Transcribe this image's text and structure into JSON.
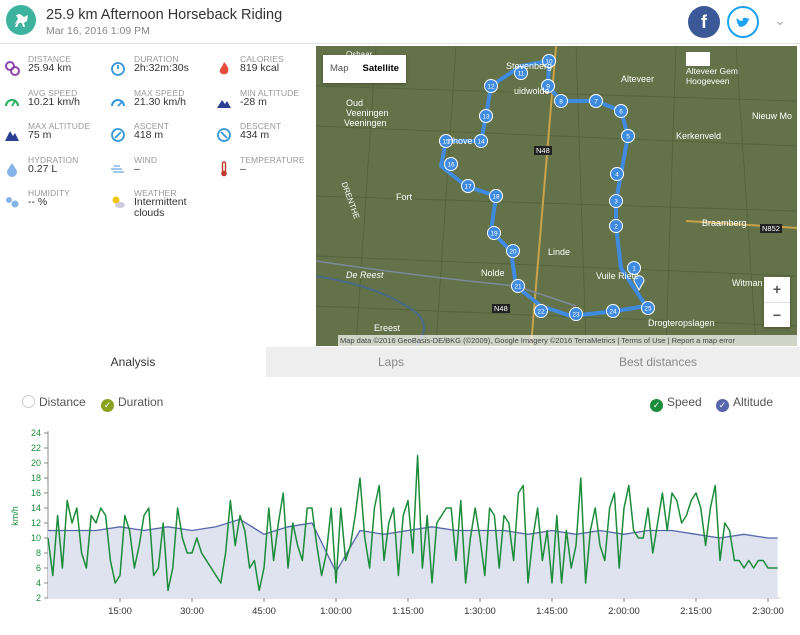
{
  "header": {
    "title": "25.9 km Afternoon Horseback Riding",
    "date": "Mar 16, 2016 1:09 PM",
    "facebook_label": "f"
  },
  "colors": {
    "accent": "#3db39e",
    "speed": "#1b8c3a",
    "altitude": "#5566aa",
    "altitude_fill": "#dfe3f0",
    "facebook": "#3b5998",
    "twitter": "#1da1f2"
  },
  "stats": [
    {
      "icon": "distance-icon",
      "label": "DISTANCE",
      "value": "25.94 km",
      "color": "#8e44ad"
    },
    {
      "icon": "duration-icon",
      "label": "DURATION",
      "value": "2h:32m:30s",
      "color": "#3498db"
    },
    {
      "icon": "calories-icon",
      "label": "CALORIES",
      "value": "819 kcal",
      "color": "#e74c3c"
    },
    {
      "icon": "avg-speed-icon",
      "label": "AVG SPEED",
      "value": "10.21 km/h",
      "color": "#27ae60"
    },
    {
      "icon": "max-speed-icon",
      "label": "MAX SPEED",
      "value": "21.30 km/h",
      "color": "#3498db"
    },
    {
      "icon": "min-altitude-icon",
      "label": "MIN ALTITUDE",
      "value": "-28 m",
      "color": "#2c3e8f"
    },
    {
      "icon": "max-altitude-icon",
      "label": "MAX ALTITUDE",
      "value": "75 m",
      "color": "#2c3e8f"
    },
    {
      "icon": "ascent-icon",
      "label": "ASCENT",
      "value": "418 m",
      "color": "#3498db"
    },
    {
      "icon": "descent-icon",
      "label": "DESCENT",
      "value": "434 m",
      "color": "#3498db"
    },
    {
      "icon": "hydration-icon",
      "label": "HYDRATION",
      "value": "0.27 L",
      "color": "#85b5e8"
    },
    {
      "icon": "wind-icon",
      "label": "WIND",
      "value": "–",
      "color": "#85b5e8"
    },
    {
      "icon": "temperature-icon",
      "label": "TEMPERATURE",
      "value": "–",
      "color": "#c0392b"
    },
    {
      "icon": "humidity-icon",
      "label": "HUMIDITY",
      "value": "-- %",
      "color": "#85b5e8"
    },
    {
      "icon": "weather-icon",
      "label": "WEATHER",
      "value": "Intermittent clouds",
      "color": "#f1c40f"
    }
  ],
  "map": {
    "type_buttons": [
      "Map",
      "Satellite"
    ],
    "selected_type": "Satellite",
    "zoom_in": "+",
    "zoom_out": "−",
    "attribution": "Map data ©2016 GeoBasis-DE/BKG (©2009), Google Imagery ©2016 TerraMetrics | Terms of Use | Report a map error",
    "labels": [
      "Oud Veeningen",
      "Veeningen",
      "Fort",
      "Nolde",
      "Linde",
      "De Reest",
      "Alteveer",
      "Alteveer Gem Hoogeveen",
      "Kerkenveld",
      "Nieuw Mo",
      "Braamberg",
      "Witman",
      "Drogteropslagen",
      "Vuile Riete",
      "N48",
      "N852",
      "DRENTHE",
      "OVERIJSSEL",
      "Oshaar",
      "uidwolde",
      "nhove",
      "Stevenberg",
      "Ereest"
    ],
    "route_markers": [
      "1",
      "2",
      "3",
      "4",
      "5",
      "6",
      "7",
      "8",
      "9",
      "10",
      "11",
      "12",
      "13",
      "14",
      "15",
      "16",
      "17",
      "18",
      "19",
      "20",
      "21",
      "22",
      "23",
      "24",
      "25"
    ]
  },
  "tabs": [
    {
      "label": "Analysis",
      "active": true
    },
    {
      "label": "Laps",
      "active": false
    },
    {
      "label": "Best distances",
      "active": false
    }
  ],
  "toggles": {
    "x_axis": [
      {
        "label": "Distance",
        "checked": false
      },
      {
        "label": "Duration",
        "checked": true
      }
    ],
    "series": [
      {
        "label": "Speed",
        "checked": true
      },
      {
        "label": "Altitude",
        "checked": true
      }
    ]
  },
  "chart_data": {
    "type": "line",
    "ylabel": "km/h",
    "ylim": [
      2,
      24
    ],
    "yticks": [
      2,
      4,
      6,
      8,
      10,
      12,
      14,
      16,
      18,
      20,
      22,
      24
    ],
    "x_ticks": [
      "15:00",
      "30:00",
      "45:00",
      "1:00:00",
      "1:15:00",
      "1:30:00",
      "1:45:00",
      "2:00:00",
      "2:15:00",
      "2:30:00"
    ],
    "x_tick_minutes": [
      15,
      30,
      45,
      60,
      75,
      90,
      105,
      120,
      135,
      150
    ],
    "xlim_minutes": [
      0,
      152.5
    ],
    "series": [
      {
        "name": "Speed",
        "color": "#1b8c3a",
        "x_minutes": [
          0,
          1,
          2,
          3,
          4,
          5,
          6,
          7,
          8,
          9,
          10,
          11,
          12,
          13,
          14,
          15,
          16,
          17,
          18,
          19,
          20,
          21,
          22,
          23,
          24,
          25,
          26,
          27,
          28,
          29,
          30,
          31,
          32,
          33,
          34,
          35,
          36,
          37,
          38,
          39,
          40,
          41,
          42,
          43,
          44,
          45,
          46,
          47,
          48,
          49,
          50,
          51,
          52,
          53,
          54,
          55,
          56,
          57,
          58,
          59,
          60,
          61,
          62,
          63,
          64,
          65,
          66,
          67,
          68,
          69,
          70,
          71,
          72,
          73,
          74,
          75,
          76,
          77,
          78,
          79,
          80,
          81,
          82,
          83,
          84,
          85,
          86,
          87,
          88,
          89,
          90,
          91,
          92,
          93,
          94,
          95,
          96,
          97,
          98,
          99,
          100,
          101,
          102,
          103,
          104,
          105,
          106,
          107,
          108,
          109,
          110,
          111,
          112,
          113,
          114,
          115,
          116,
          117,
          118,
          119,
          120,
          121,
          122,
          123,
          124,
          125,
          126,
          127,
          128,
          129,
          130,
          131,
          132,
          133,
          134,
          135,
          136,
          137,
          138,
          139,
          140,
          141,
          142,
          143,
          144,
          145,
          146,
          147,
          148,
          149,
          150,
          151,
          152
        ],
        "values": [
          10,
          5,
          13,
          6,
          15,
          12,
          14,
          8,
          6,
          13,
          12,
          14,
          13,
          7,
          4,
          5,
          13,
          11,
          6,
          9,
          13,
          14,
          5,
          6,
          12,
          3,
          6,
          14,
          10,
          8,
          8,
          10,
          8,
          7,
          6,
          5,
          4,
          8,
          15,
          9,
          13,
          11,
          6,
          7,
          3,
          6,
          14,
          7,
          12,
          16,
          6,
          12,
          9,
          7,
          14,
          14,
          9,
          5,
          8,
          14,
          4,
          14,
          7,
          9,
          13,
          18,
          10,
          6,
          14,
          17,
          7,
          12,
          14,
          5,
          13,
          15,
          8,
          21,
          6,
          13,
          4,
          12,
          13,
          14,
          14,
          7,
          15,
          4,
          10,
          14,
          10,
          5,
          14,
          13,
          6,
          13,
          12,
          7,
          16,
          17,
          4,
          10,
          14,
          7,
          11,
          4,
          13,
          4,
          11,
          6,
          9,
          18,
          4,
          11,
          14,
          9,
          7,
          14,
          16,
          6,
          14,
          17,
          11,
          10,
          10,
          14,
          8,
          12,
          16,
          11,
          16,
          15,
          12,
          13,
          15,
          16,
          14,
          9,
          14,
          17,
          7,
          12,
          11,
          7,
          7,
          6,
          7,
          6,
          7,
          7,
          6,
          6,
          6
        ]
      },
      {
        "name": "Altitude",
        "color": "#5566aa",
        "x_minutes": [
          0,
          5,
          10,
          15,
          20,
          25,
          30,
          35,
          40,
          45,
          50,
          55,
          60,
          65,
          70,
          75,
          80,
          85,
          90,
          95,
          100,
          105,
          110,
          115,
          120,
          125,
          130,
          135,
          140,
          145,
          150,
          152
        ],
        "values": [
          11,
          11,
          11,
          11.5,
          11,
          11.5,
          11,
          11.5,
          12.5,
          10.5,
          11.5,
          12,
          5.5,
          11,
          10.5,
          11,
          11.5,
          11,
          11,
          11,
          10.5,
          11,
          10.5,
          11,
          10.5,
          11,
          11,
          10.5,
          10,
          10.5,
          10,
          10
        ]
      }
    ]
  }
}
